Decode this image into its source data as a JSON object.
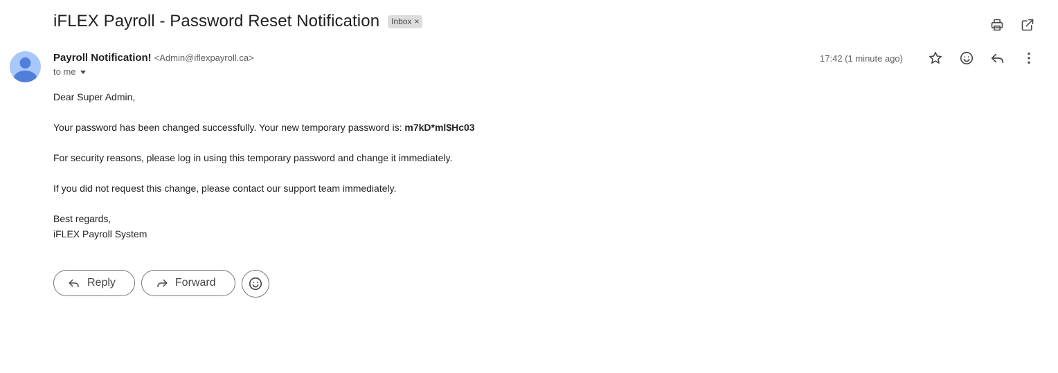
{
  "email": {
    "subject": "iFLEX Payroll - Password Reset Notification",
    "label": "Inbox",
    "label_remove": "×"
  },
  "sender": {
    "name": "Payroll Notification!",
    "email": "<Admin@iflexpayroll.ca>",
    "to": "to me",
    "timestamp": "17:42 (1 minute ago)"
  },
  "body": {
    "greeting": "Dear Super Admin,",
    "line1_prefix": "Your password has been changed successfully. Your new temporary password is: ",
    "password": "m7kD*ml$Hc03",
    "line2": "For security reasons, please log in using this temporary password and change it immediately.",
    "line3": "If you did not request this change, please contact our support team immediately.",
    "signoff": "Best regards,",
    "signature": "iFLEX Payroll System"
  },
  "actions": {
    "reply": "Reply",
    "forward": "Forward"
  },
  "icons": {
    "print": "print-icon",
    "open_new_window": "open-in-new-icon",
    "star": "star-icon",
    "emoji": "emoji-icon",
    "reply": "reply-icon",
    "more": "more-vert-icon",
    "forward": "forward-icon"
  },
  "colors": {
    "avatar_bg": "#a8c7fa",
    "avatar_fg": "#4f7fd8",
    "label_chip": "#dddddd"
  }
}
